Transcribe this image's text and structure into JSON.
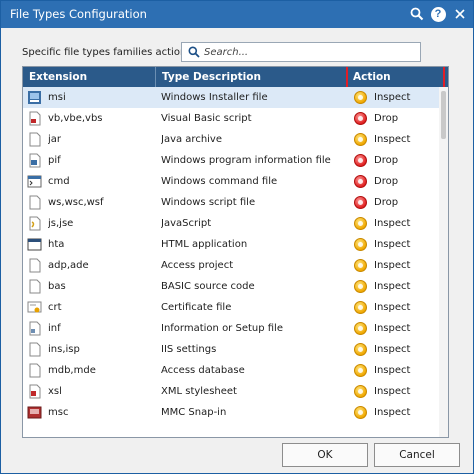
{
  "window": {
    "title": "File Types Configuration"
  },
  "search": {
    "label": "Specific file types families actions:",
    "placeholder": "Search..."
  },
  "table": {
    "columns": [
      "Extension",
      "Type Description",
      "Action"
    ],
    "rows": [
      {
        "icon": "msi-file-icon",
        "extension": "msi",
        "description": "Windows Installer file",
        "action": "Inspect",
        "selected": true
      },
      {
        "icon": "vbs-file-icon",
        "extension": "vb,vbe,vbs",
        "description": "Visual Basic script",
        "action": "Drop"
      },
      {
        "icon": "jar-file-icon",
        "extension": "jar",
        "description": "Java archive",
        "action": "Inspect"
      },
      {
        "icon": "pif-file-icon",
        "extension": "pif",
        "description": "Windows program information file",
        "action": "Drop"
      },
      {
        "icon": "cmd-file-icon",
        "extension": "cmd",
        "description": "Windows command file",
        "action": "Drop"
      },
      {
        "icon": "wsf-file-icon",
        "extension": "ws,wsc,wsf",
        "description": "Windows script file",
        "action": "Drop"
      },
      {
        "icon": "js-file-icon",
        "extension": "js,jse",
        "description": "JavaScript",
        "action": "Inspect"
      },
      {
        "icon": "hta-file-icon",
        "extension": "hta",
        "description": "HTML application",
        "action": "Inspect"
      },
      {
        "icon": "adp-file-icon",
        "extension": "adp,ade",
        "description": "Access project",
        "action": "Inspect"
      },
      {
        "icon": "bas-file-icon",
        "extension": "bas",
        "description": "BASIC source code",
        "action": "Inspect"
      },
      {
        "icon": "crt-file-icon",
        "extension": "crt",
        "description": "Certificate file",
        "action": "Inspect"
      },
      {
        "icon": "inf-file-icon",
        "extension": "inf",
        "description": "Information or Setup file",
        "action": "Inspect"
      },
      {
        "icon": "isp-file-icon",
        "extension": "ins,isp",
        "description": "IIS settings",
        "action": "Inspect"
      },
      {
        "icon": "mdb-file-icon",
        "extension": "mdb,mde",
        "description": "Access database",
        "action": "Inspect"
      },
      {
        "icon": "xsl-file-icon",
        "extension": "xsl",
        "description": "XML stylesheet",
        "action": "Inspect"
      },
      {
        "icon": "msc-file-icon",
        "extension": "msc",
        "description": "MMC Snap-in",
        "action": "Inspect"
      }
    ]
  },
  "buttons": {
    "ok": "OK",
    "cancel": "Cancel"
  },
  "colors": {
    "titlebar": "#2d6fb3",
    "header": "#2b5a8a",
    "highlight": "#e11d26",
    "inspect": "#f0a800",
    "drop": "#e02020"
  }
}
